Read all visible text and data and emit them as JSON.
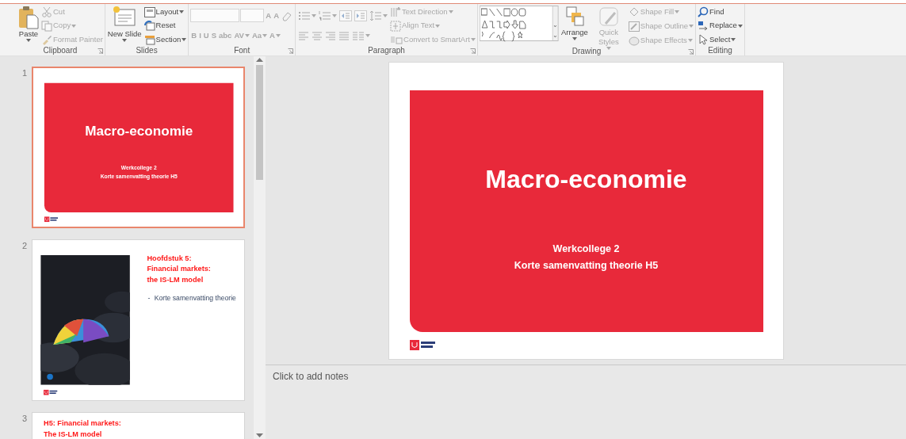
{
  "ribbon": {
    "groups": [
      {
        "label": "Clipboard",
        "launcher": true,
        "columns": [
          [
            {
              "kind": "large",
              "label": "Paste",
              "dropdown": true,
              "disabled": false
            }
          ],
          [
            {
              "kind": "small",
              "label": "Cut",
              "dropdown": false,
              "disabled": true
            },
            {
              "kind": "small",
              "label": "Copy",
              "dropdown": true,
              "disabled": true
            },
            {
              "kind": "small",
              "label": "Format Painter",
              "dropdown": false,
              "disabled": true
            }
          ]
        ]
      },
      {
        "label": "Slides",
        "launcher": false,
        "columns": [
          [
            {
              "kind": "large",
              "label": "New Slide",
              "dropdown": true,
              "disabled": false
            }
          ],
          [
            {
              "kind": "small",
              "label": "Layout",
              "dropdown": true,
              "disabled": false
            },
            {
              "kind": "small",
              "label": "Reset",
              "dropdown": false,
              "disabled": false
            },
            {
              "kind": "small",
              "label": "Section",
              "dropdown": true,
              "disabled": false
            }
          ]
        ]
      },
      {
        "label": "Font",
        "launcher": true,
        "columns": [
          [
            {
              "kind": "iconrow",
              "buttons": [
                {
                  "kind": "field",
                  "disabled": true
                },
                {
                  "kind": "field",
                  "disabled": true
                },
                {
                  "kind": "text",
                  "label": "A",
                  "dropdown": false,
                  "disabled": true
                },
                {
                  "kind": "text",
                  "label": "A",
                  "dropdown": false,
                  "disabled": true
                },
                {
                  "kind": "icon",
                  "dropdown": false,
                  "disabled": true
                }
              ]
            },
            {
              "kind": "iconrow",
              "buttons": [
                {
                  "kind": "text",
                  "label": "B",
                  "dropdown": false,
                  "disabled": true
                },
                {
                  "kind": "text",
                  "label": "I",
                  "dropdown": false,
                  "disabled": true
                },
                {
                  "kind": "text",
                  "label": "U",
                  "dropdown": false,
                  "disabled": true
                },
                {
                  "kind": "text",
                  "label": "S",
                  "dropdown": false,
                  "disabled": true
                },
                {
                  "kind": "text",
                  "label": "abc",
                  "dropdown": false,
                  "disabled": true
                },
                {
                  "kind": "text",
                  "label": "AV",
                  "dropdown": true,
                  "disabled": true
                },
                {
                  "kind": "text",
                  "label": "Aa",
                  "dropdown": true,
                  "disabled": true
                },
                {
                  "kind": "text",
                  "label": "A",
                  "dropdown": true,
                  "disabled": true
                }
              ]
            }
          ]
        ]
      },
      {
        "label": "Paragraph",
        "launcher": true,
        "columns": [
          [
            {
              "kind": "iconrow",
              "buttons": [
                {
                  "kind": "icon",
                  "dropdown": true,
                  "disabled": true
                },
                {
                  "kind": "icon",
                  "dropdown": true,
                  "disabled": true
                },
                {
                  "kind": "icon",
                  "dropdown": false,
                  "disabled": true
                },
                {
                  "kind": "icon",
                  "dropdown": false,
                  "disabled": true
                },
                {
                  "kind": "icon",
                  "dropdown": true,
                  "disabled": true
                }
              ]
            },
            {
              "kind": "iconrow",
              "buttons": [
                {
                  "kind": "icon",
                  "dropdown": false,
                  "disabled": true
                },
                {
                  "kind": "icon",
                  "dropdown": false,
                  "disabled": true
                },
                {
                  "kind": "icon",
                  "dropdown": false,
                  "disabled": true
                },
                {
                  "kind": "icon",
                  "dropdown": false,
                  "disabled": true
                },
                {
                  "kind": "icon",
                  "dropdown": true,
                  "disabled": true
                }
              ]
            }
          ],
          [
            {
              "kind": "small",
              "label": "Text Direction",
              "dropdown": true,
              "disabled": true
            },
            {
              "kind": "small",
              "label": "Align Text",
              "dropdown": true,
              "disabled": true
            },
            {
              "kind": "small",
              "label": "Convert to SmartArt",
              "dropdown": true,
              "disabled": true
            }
          ]
        ]
      },
      {
        "label": "Drawing",
        "launcher": true,
        "columns": [
          [
            {
              "kind": "gallery",
              "disabled": false
            }
          ],
          [
            {
              "kind": "large",
              "label": "Arrange",
              "dropdown": true,
              "disabled": false
            }
          ],
          [
            {
              "kind": "large",
              "label": "Quick Styles",
              "dropdown": true,
              "disabled": true
            }
          ],
          [
            {
              "kind": "small",
              "label": "Shape Fill",
              "dropdown": true,
              "disabled": true
            },
            {
              "kind": "small",
              "label": "Shape Outline",
              "dropdown": true,
              "disabled": true
            },
            {
              "kind": "small",
              "label": "Shape Effects",
              "dropdown": true,
              "disabled": true
            }
          ]
        ]
      },
      {
        "label": "Editing",
        "launcher": false,
        "columns": [
          [
            {
              "kind": "small",
              "label": "Find",
              "dropdown": false,
              "disabled": false
            },
            {
              "kind": "small",
              "label": "Replace",
              "dropdown": true,
              "disabled": false
            },
            {
              "kind": "small",
              "label": "Select",
              "dropdown": true,
              "disabled": false
            }
          ]
        ]
      }
    ]
  },
  "thumbnails": [
    {
      "number": "1",
      "selected": true,
      "kind": "title",
      "title": "Macro-economie",
      "subtitle": [
        "Werkcollege 2",
        "Korte samenvatting theorie H5"
      ]
    },
    {
      "number": "2",
      "selected": false,
      "kind": "content",
      "title": [
        "Hoofdstuk 5:",
        "Financial markets:",
        "the IS-LM model"
      ],
      "bullets": [
        {
          "marker": "-",
          "text": "Korte samenvatting theorie"
        }
      ]
    },
    {
      "number": "3",
      "selected": false,
      "kind": "section",
      "title": [
        "H5: Financial markets:",
        "The IS-LM model"
      ]
    }
  ],
  "editor": {
    "slide": {
      "kind": "title",
      "title": "Macro-economie",
      "subtitle": [
        "Werkcollege 2",
        "Korte samenvatting theorie H5"
      ]
    },
    "notes": {
      "placeholder": "Click to add notes"
    }
  }
}
